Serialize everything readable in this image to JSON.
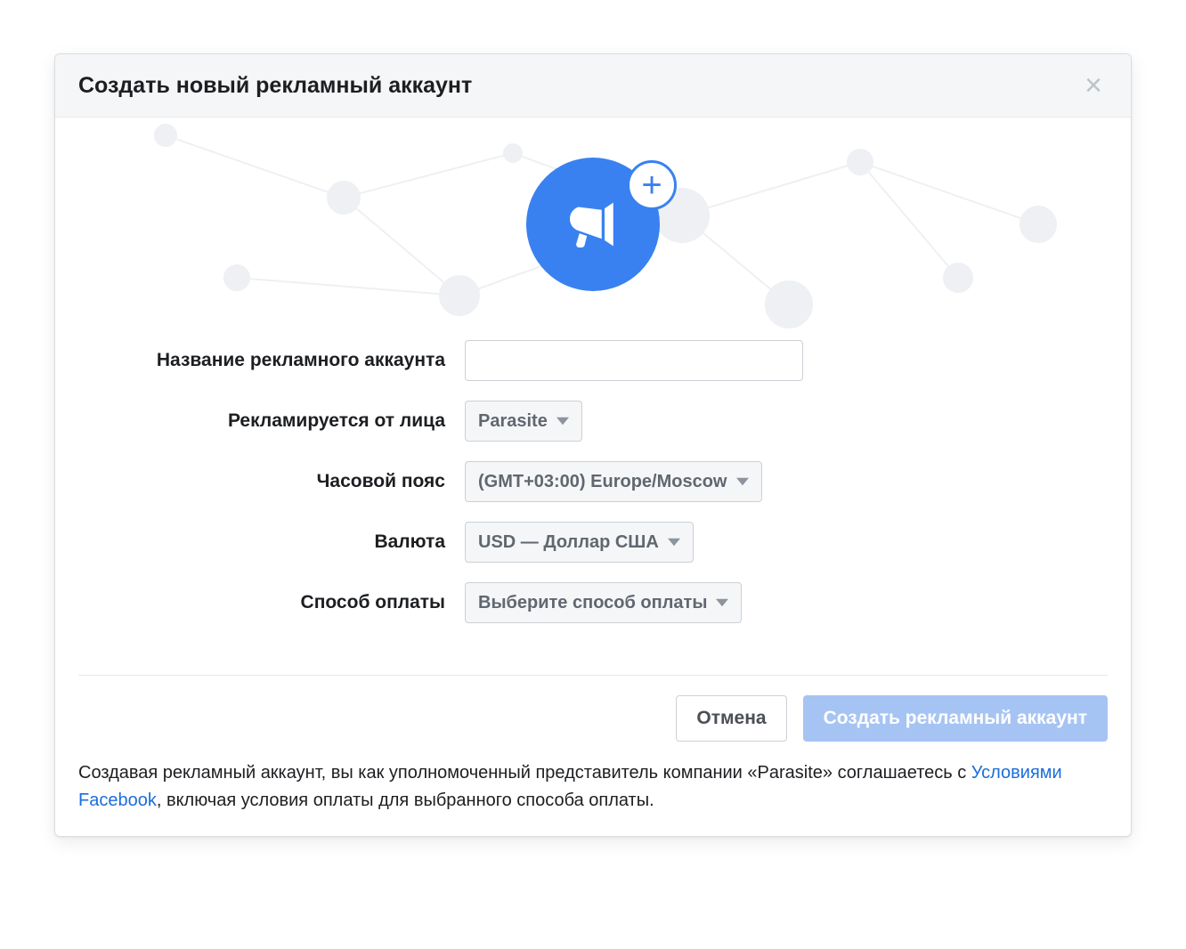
{
  "modal": {
    "title": "Создать новый рекламный аккаунт"
  },
  "hero": {
    "icon_name": "megaphone-icon",
    "plus_icon_name": "plus-icon"
  },
  "form": {
    "account_name": {
      "label": "Название рекламного аккаунта",
      "value": ""
    },
    "advertiser": {
      "label": "Рекламируется от лица",
      "selected": "Parasite"
    },
    "timezone": {
      "label": "Часовой пояс",
      "selected": "(GMT+03:00) Europe/Moscow"
    },
    "currency": {
      "label": "Валюта",
      "selected": "USD — Доллар США"
    },
    "payment": {
      "label": "Способ оплаты",
      "selected": "Выберите способ оплаты"
    }
  },
  "actions": {
    "cancel": "Отмена",
    "submit": "Создать рекламный аккаунт"
  },
  "disclaimer": {
    "part1": "Создавая рекламный аккаунт, вы как уполномоченный представитель компании «Parasite» соглашаетесь с ",
    "link_text": "Условиями Facebook",
    "part2": ", включая условия оплаты для выбранного способа оплаты."
  },
  "colors": {
    "accent": "#3981f0",
    "link": "#1a6ed8",
    "muted": "#606770",
    "border": "#ccd0d5"
  }
}
